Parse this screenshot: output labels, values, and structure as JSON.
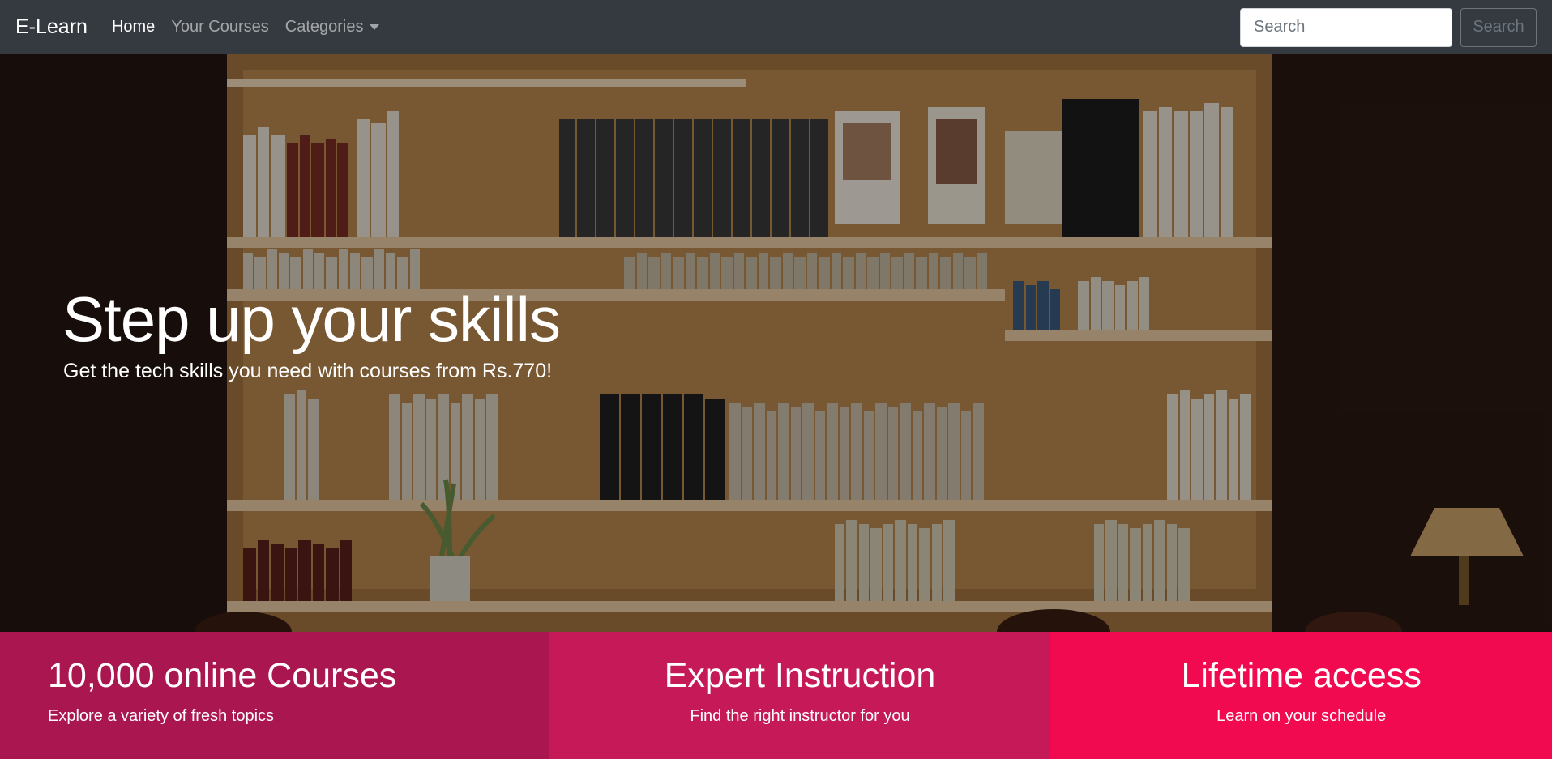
{
  "navbar": {
    "brand": "E-Learn",
    "links": [
      {
        "label": "Home",
        "active": true
      },
      {
        "label": "Your Courses",
        "active": false
      },
      {
        "label": "Categories",
        "active": false,
        "dropdown": true
      }
    ],
    "search": {
      "placeholder": "Search",
      "value": "",
      "button_label": "Search"
    }
  },
  "hero": {
    "title": "Step up your skills",
    "subtitle": "Get the tech skills you need with courses from Rs.770!"
  },
  "features": [
    {
      "title": "10,000 online Courses",
      "subtitle": "Explore a variety of fresh topics",
      "color": "#a91650"
    },
    {
      "title": "Expert Instruction",
      "subtitle": "Find the right instructor for you",
      "color": "#c61a58"
    },
    {
      "title": "Lifetime access",
      "subtitle": "Learn on your schedule",
      "color": "#f20a51"
    }
  ],
  "colors": {
    "navbar_bg": "#343a40"
  }
}
